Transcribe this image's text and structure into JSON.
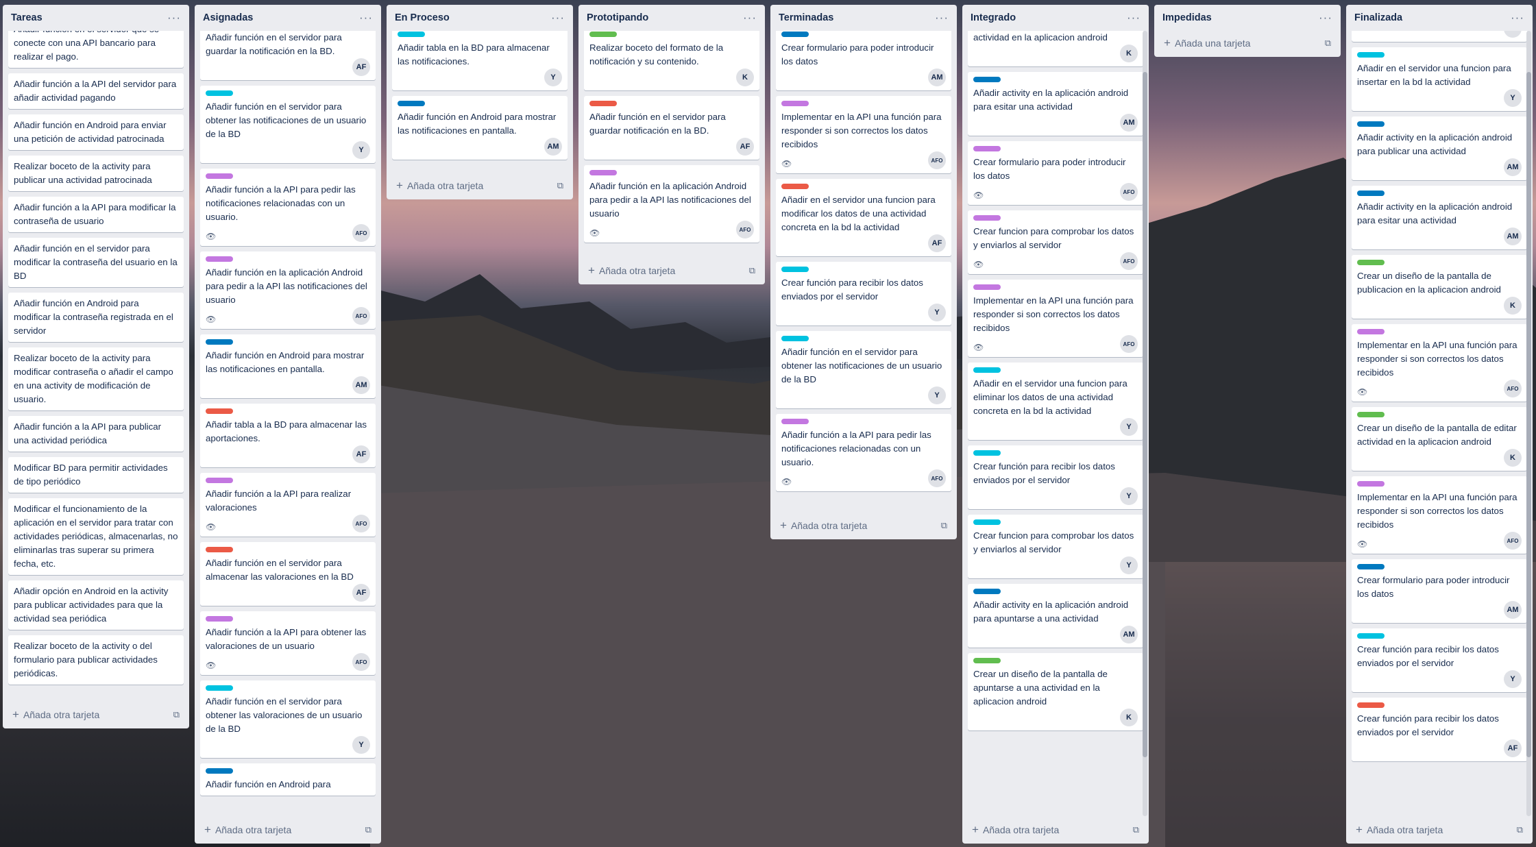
{
  "labels": {
    "cyan": "#00c2e0",
    "blue": "#0079bf",
    "purple": "#c377e0",
    "red": "#eb5a46",
    "green": "#61bd4f"
  },
  "lists": [
    {
      "title": "Tareas",
      "add": "Añada otra tarjeta",
      "cards": [
        {
          "text": "Añadir función en el servidor que se conecte con una API bancario para realizar el pago."
        },
        {
          "text": "Añadir función a la API del servidor para añadir actividad pagando"
        },
        {
          "text": "Añadir función en Android para enviar una petición de actividad patrocinada"
        },
        {
          "text": "Realizar boceto de la activity para publicar una actividad patrocinada"
        },
        {
          "text": "Añadir función a la API para modificar la contraseña de usuario"
        },
        {
          "text": "Añadir función en el servidor para modificar la contraseña del usuario en la BD"
        },
        {
          "text": "Añadir función en Android para modificar la contraseña registrada en el servidor"
        },
        {
          "text": "Realizar boceto de la activity para modificar contraseña o añadir el campo en una activity de modificación de usuario."
        },
        {
          "text": "Añadir función a la API para publicar una actividad periódica"
        },
        {
          "text": "Modificar BD para permitir actividades de tipo periódico"
        },
        {
          "text": "Modificar el funcionamiento de la aplicación en el servidor para tratar con actividades periódicas, almacenarlas, no eliminarlas tras superar su primera fecha, etc."
        },
        {
          "text": "Añadir opción en Android en la activity para publicar actividades para que la actividad sea periódica"
        },
        {
          "text": "Realizar boceto de la activity o del formulario para publicar actividades periódicas."
        }
      ]
    },
    {
      "title": "Asignadas",
      "add": "Añada otra tarjeta",
      "cards": [
        {
          "text": "Añadir función en el servidor para guardar la notificación en la BD.",
          "member": "AF"
        },
        {
          "label": "cyan",
          "text": "Añadir función en el servidor para obtener las notificaciones de un usuario de la BD",
          "member": "Y"
        },
        {
          "label": "purple",
          "text": "Añadir función a la API para pedir las notificaciones relacionadas con un usuario.",
          "eye": true,
          "member": "AFO"
        },
        {
          "label": "purple",
          "text": "Añadir función en la aplicación Android para pedir a la API las notificaciones del usuario",
          "eye": true,
          "member": "AFO"
        },
        {
          "label": "blue",
          "text": "Añadir función en Android para mostrar las notificaciones en pantalla.",
          "member": "AM"
        },
        {
          "label": "red",
          "text": "Añadir tabla a la BD para almacenar las aportaciones.",
          "member": "AF"
        },
        {
          "label": "purple",
          "text": "Añadir función a la API para realizar valoraciones",
          "eye": true,
          "member": "AFO"
        },
        {
          "label": "red",
          "text": "Añadir función en el servidor para almacenar las valoraciones en la BD",
          "member": "AF"
        },
        {
          "label": "purple",
          "text": "Añadir función a la API para obtener las valoraciones de un usuario",
          "eye": true,
          "member": "AFO"
        },
        {
          "label": "cyan",
          "text": "Añadir función en el servidor para obtener las valoraciones de un usuario de la BD",
          "member": "Y"
        },
        {
          "label": "blue",
          "text": "Añadir función en Android para"
        }
      ]
    },
    {
      "title": "En Proceso",
      "add": "Añada otra tarjeta",
      "cards": [
        {
          "label": "cyan",
          "text": "Añadir tabla en la BD para almacenar las notificaciones.",
          "member": "Y"
        },
        {
          "label": "blue",
          "text": "Añadir función en Android para mostrar las notificaciones en pantalla.",
          "member": "AM"
        }
      ]
    },
    {
      "title": "Prototipando",
      "add": "Añada otra tarjeta",
      "cards": [
        {
          "label": "green",
          "text": "Realizar boceto del formato de la notificación y su contenido.",
          "member": "K"
        },
        {
          "label": "red",
          "text": "Añadir función en el servidor para guardar notificación en la BD.",
          "member": "AF"
        },
        {
          "label": "purple",
          "text": "Añadir función en la aplicación Android para pedir a la API las notificaciones del usuario",
          "eye": true,
          "member": "AFO"
        }
      ]
    },
    {
      "title": "Terminadas",
      "add": "Añada otra tarjeta",
      "cards": [
        {
          "label": "blue",
          "text": "Crear formulario para poder introducir los datos",
          "member": "AM"
        },
        {
          "label": "purple",
          "text": "Implementar en la API una función para responder si son correctos los datos recibidos",
          "eye": true,
          "member": "AFO"
        },
        {
          "label": "red",
          "text": "Añadir en el servidor una funcion para modificar los datos de una actividad concreta en la bd la actividad",
          "member": "AF"
        },
        {
          "label": "cyan",
          "text": "Crear función para recibir los datos enviados por el servidor",
          "member": "Y"
        },
        {
          "label": "cyan",
          "text": "Añadir función en el servidor para obtener las notificaciones de un usuario de la BD",
          "member": "Y"
        },
        {
          "label": "purple",
          "text": "Añadir función a la API para pedir las notificaciones relacionadas con un usuario.",
          "eye": true,
          "member": "AFO"
        }
      ]
    },
    {
      "title": "Integrado",
      "add": "Añada otra tarjeta",
      "cards": [
        {
          "text": "Crear un diseño de la pantalla de editar actividad en la aplicacion android",
          "member": "K"
        },
        {
          "label": "blue",
          "text": "Añadir activity en la aplicación android para esitar una actividad",
          "member": "AM"
        },
        {
          "label": "purple",
          "text": "Crear formulario para poder introducir los datos",
          "eye": true,
          "member": "AFO"
        },
        {
          "label": "purple",
          "text": "Crear funcion para comprobar los datos y enviarlos al servidor",
          "eye": true,
          "member": "AFO"
        },
        {
          "label": "purple",
          "text": "Implementar en la API una función para responder si son correctos los datos recibidos",
          "eye": true,
          "member": "AFO"
        },
        {
          "label": "cyan",
          "text": "Añadir en el servidor una funcion para eliminar los datos de una actividad concreta en la bd la actividad",
          "member": "Y"
        },
        {
          "label": "cyan",
          "text": "Crear función para recibir los datos enviados por el servidor",
          "member": "Y"
        },
        {
          "label": "cyan",
          "text": "Crear funcion para comprobar los datos y enviarlos al servidor",
          "member": "Y"
        },
        {
          "label": "blue",
          "text": "Añadir activity en la aplicación android para apuntarse a una actividad",
          "member": "AM"
        },
        {
          "label": "green",
          "text": "Crear un diseño de la pantalla de apuntarse a una actividad en la aplicacion android",
          "member": "K"
        }
      ]
    },
    {
      "title": "Impedidas",
      "add": "Añada una tarjeta",
      "cards": []
    },
    {
      "title": "Finalizada",
      "add": "Añada otra tarjeta",
      "cards": [
        {
          "text": "",
          "member": "Y"
        },
        {
          "label": "cyan",
          "text": "Añadir en el servidor una funcion para insertar en la bd la actividad",
          "member": "Y"
        },
        {
          "label": "blue",
          "text": "Añadir activity en la aplicación android para publicar una actividad",
          "member": "AM"
        },
        {
          "label": "blue",
          "text": "Añadir activity en la aplicación android para esitar una actividad",
          "member": "AM"
        },
        {
          "label": "green",
          "text": "Crear un diseño de la pantalla de publicacion en la aplicacion android",
          "member": "K"
        },
        {
          "label": "purple",
          "text": "Implementar en la API una función para responder si son correctos los datos recibidos",
          "eye": true,
          "member": "AFO"
        },
        {
          "label": "green",
          "text": "Crear un diseño de la pantalla de editar actividad en la aplicacion android",
          "member": "K"
        },
        {
          "label": "purple",
          "text": "Implementar en la API una función para responder si son correctos los datos recibidos",
          "eye": true,
          "member": "AFO"
        },
        {
          "label": "blue",
          "text": "Crear formulario para poder introducir los datos",
          "member": "AM"
        },
        {
          "label": "cyan",
          "text": "Crear función para recibir los datos enviados por el servidor",
          "member": "Y"
        },
        {
          "label": "red",
          "text": "Crear función para recibir los datos enviados por el servidor",
          "member": "AF"
        }
      ]
    }
  ]
}
